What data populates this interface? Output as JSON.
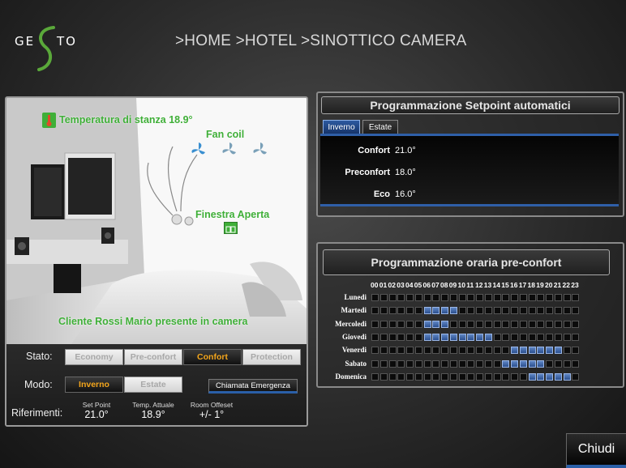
{
  "brand": {
    "logo_left": "GE",
    "logo_right": "TO"
  },
  "breadcrumb": ">HOME >HOTEL >SINOTTICO CAMERA",
  "room": {
    "temperature_label": "Temperatura di stanza 18.9°",
    "fan_coil_label": "Fan coil",
    "window_label": "Finestra Aperta",
    "guest_label": "Cliente Rossi Mario presente in camera"
  },
  "controls": {
    "stato_label": "Stato:",
    "stato_options": [
      "Economy",
      "Pre-confort",
      "Confort",
      "Protection"
    ],
    "stato_active": 2,
    "modo_label": "Modo:",
    "modo_options": [
      "Inverno",
      "Estate"
    ],
    "modo_active": 0,
    "emergency_label": "Chiamata Emergenza",
    "riferimenti_label": "Riferimenti:",
    "references": [
      {
        "title": "Set Point",
        "value": "21.0°"
      },
      {
        "title": "Temp. Attuale",
        "value": "18.9°"
      },
      {
        "title": "Room Offeset",
        "value": "+/- 1°"
      }
    ]
  },
  "setpoint": {
    "title": "Programmazione Setpoint automatici",
    "tabs": [
      "Inverno",
      "Estate"
    ],
    "active_tab": 0,
    "rows": [
      {
        "label": "Confort",
        "value": "21.0°"
      },
      {
        "label": "Preconfort",
        "value": "18.0°"
      },
      {
        "label": "Eco",
        "value": "16.0°"
      }
    ]
  },
  "schedule": {
    "title": "Programmazione oraria pre-confort",
    "hours": [
      "00",
      "01",
      "02",
      "03",
      "04",
      "05",
      "06",
      "07",
      "08",
      "09",
      "10",
      "11",
      "12",
      "13",
      "14",
      "15",
      "16",
      "17",
      "18",
      "19",
      "20",
      "21",
      "22",
      "23"
    ],
    "days": [
      "Lunedi",
      "Martedi",
      "Mercoledi",
      "Giovedi",
      "Venerdi",
      "Sabato",
      "Domenica"
    ],
    "active": [
      [],
      [
        6,
        7,
        8,
        9
      ],
      [
        6,
        7,
        8
      ],
      [
        6,
        7,
        8,
        9,
        10,
        11,
        12,
        13
      ],
      [
        16,
        17,
        18,
        19,
        20,
        21
      ],
      [
        15,
        16,
        17,
        18,
        19
      ],
      [
        18,
        19,
        20,
        21,
        22
      ]
    ]
  },
  "close_label": "Chiudi",
  "colors": {
    "accent_blue": "#2f5fa8",
    "active_orange": "#f4a61c",
    "label_green": "#3faf38",
    "logo_green": "#5aa83a"
  }
}
